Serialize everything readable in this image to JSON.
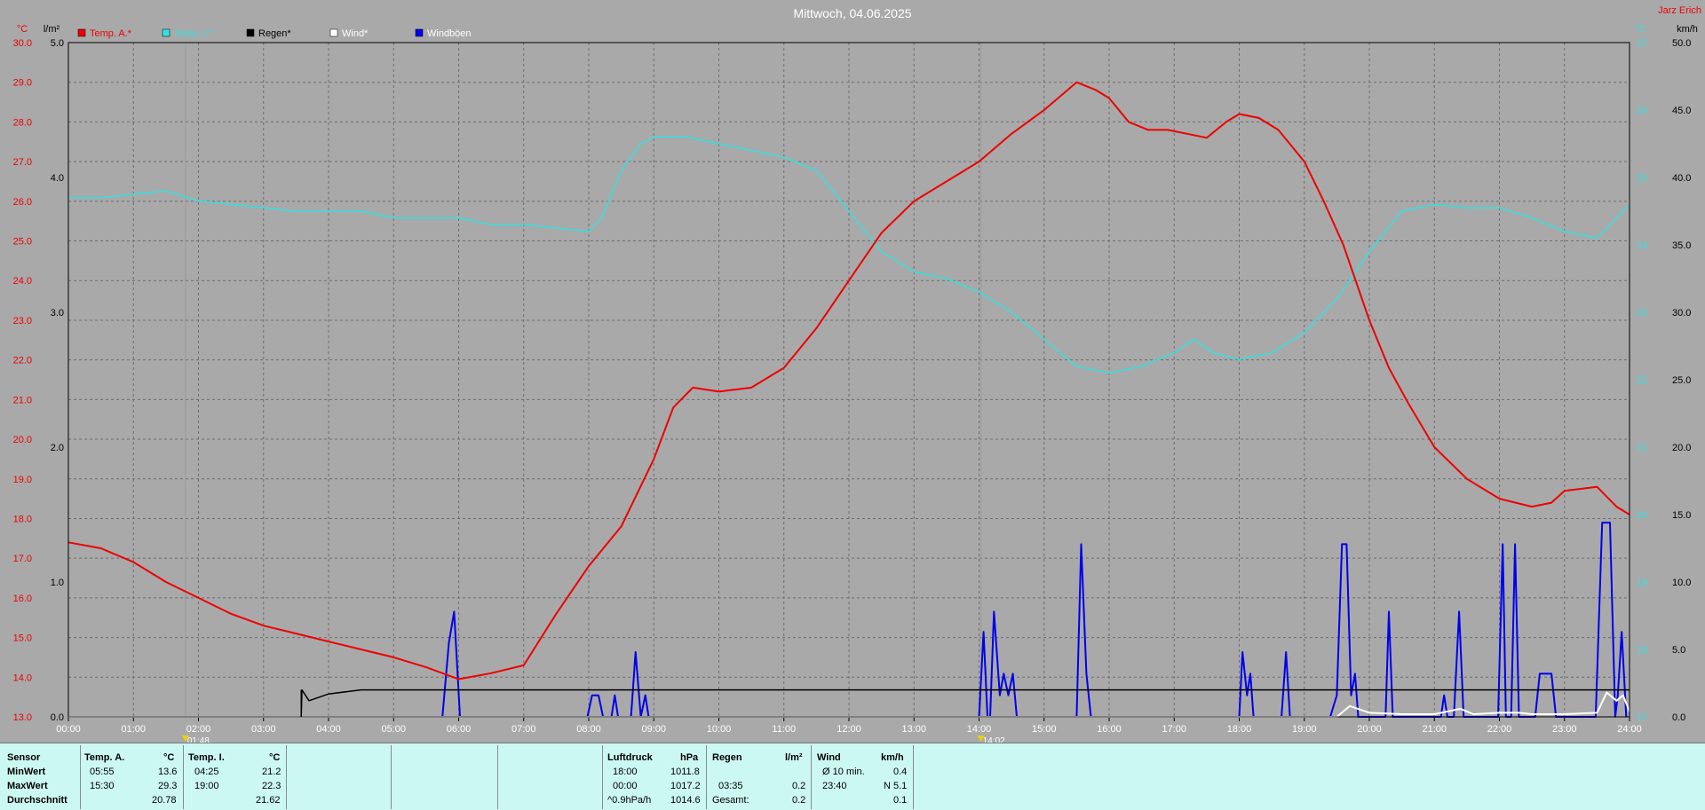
{
  "title": "Mittwoch, 04.06.2025",
  "author": "Jarz Erich",
  "colors": {
    "temp": "#ee0000",
    "tempi": "#34e0e0",
    "rain": "#000000",
    "wind": "#ffffff",
    "gusts": "#0000ee",
    "bg": "#a9a9a9"
  },
  "axes": {
    "left_unit": "°C",
    "left2_unit": "l/m²",
    "right_unit": "km/h",
    "right2_unit": "°C",
    "left_ticks": [
      "13.0",
      "14.0",
      "15.0",
      "16.0",
      "17.0",
      "18.0",
      "19.0",
      "20.0",
      "21.0",
      "22.0",
      "23.0",
      "24.0",
      "25.0",
      "26.0",
      "27.0",
      "28.0",
      "29.0",
      "30.0"
    ],
    "left2_ticks": [
      "0.0",
      "1.0",
      "2.0",
      "3.0",
      "4.0",
      "5.0"
    ],
    "right_ticks": [
      "0.0",
      "5.0",
      "10.0",
      "15.0",
      "20.0",
      "25.0",
      "30.0",
      "35.0",
      "40.0",
      "45.0",
      "50.0"
    ],
    "right2_ticks": [
      "17",
      "18",
      "19",
      "20",
      "21",
      "22",
      "23",
      "24",
      "25",
      "26",
      "27"
    ],
    "x_ticks": [
      "00:00",
      "01:00",
      "02:00",
      "03:00",
      "04:00",
      "05:00",
      "06:00",
      "07:00",
      "08:00",
      "09:00",
      "10:00",
      "11:00",
      "12:00",
      "13:00",
      "14:00",
      "15:00",
      "16:00",
      "17:00",
      "18:00",
      "19:00",
      "20:00",
      "21:00",
      "22:00",
      "23:00",
      "24:00"
    ],
    "markers": [
      {
        "time": "01:48",
        "t": 1.8
      },
      {
        "time": "14:02",
        "t": 14.03
      }
    ]
  },
  "legend": [
    {
      "label": "Temp. A.*",
      "color": "#ee0000",
      "text_color": "#ee0000"
    },
    {
      "label": "Temp. I.*",
      "color": "#34e0e0",
      "text_color": "#34e0e0"
    },
    {
      "label": "Regen*",
      "color": "#000000",
      "text_color": "#000000"
    },
    {
      "label": "Wind*",
      "color": "#ffffff",
      "text_color": "#ffffff"
    },
    {
      "label": "Windböen",
      "color": "#0000ee",
      "text_color": "#ffffff"
    }
  ],
  "chart_data": {
    "type": "line",
    "title": "Mittwoch, 04.06.2025",
    "x_unit": "hour of day",
    "xlim": [
      0,
      24
    ],
    "series": [
      {
        "name": "Temp. A.*",
        "unit": "°C",
        "axis": "left",
        "ylim": [
          13,
          30
        ],
        "points": [
          [
            0,
            17.4
          ],
          [
            0.5,
            17.25
          ],
          [
            1,
            16.9
          ],
          [
            1.5,
            16.4
          ],
          [
            2,
            16.0
          ],
          [
            2.5,
            15.6
          ],
          [
            3,
            15.3
          ],
          [
            3.5,
            15.1
          ],
          [
            4,
            14.9
          ],
          [
            4.5,
            14.7
          ],
          [
            5,
            14.5
          ],
          [
            5.5,
            14.25
          ],
          [
            6,
            13.95
          ],
          [
            6.5,
            14.1
          ],
          [
            7,
            14.3
          ],
          [
            7.5,
            15.6
          ],
          [
            8,
            16.8
          ],
          [
            8.5,
            17.8
          ],
          [
            9,
            19.5
          ],
          [
            9.3,
            20.8
          ],
          [
            9.6,
            21.3
          ],
          [
            10,
            21.2
          ],
          [
            10.5,
            21.3
          ],
          [
            11,
            21.8
          ],
          [
            11.5,
            22.8
          ],
          [
            12,
            24.0
          ],
          [
            12.5,
            25.2
          ],
          [
            13,
            26.0
          ],
          [
            13.5,
            26.5
          ],
          [
            14,
            27.0
          ],
          [
            14.5,
            27.7
          ],
          [
            15,
            28.3
          ],
          [
            15.5,
            29.0
          ],
          [
            15.8,
            28.8
          ],
          [
            16,
            28.6
          ],
          [
            16.3,
            28.0
          ],
          [
            16.6,
            27.8
          ],
          [
            16.9,
            27.8
          ],
          [
            17.2,
            27.7
          ],
          [
            17.5,
            27.6
          ],
          [
            17.8,
            28.0
          ],
          [
            18,
            28.2
          ],
          [
            18.3,
            28.1
          ],
          [
            18.6,
            27.8
          ],
          [
            19,
            27.0
          ],
          [
            19.3,
            26.0
          ],
          [
            19.6,
            24.9
          ],
          [
            20,
            23.0
          ],
          [
            20.3,
            21.8
          ],
          [
            20.6,
            20.9
          ],
          [
            21,
            19.8
          ],
          [
            21.5,
            19.0
          ],
          [
            22,
            18.5
          ],
          [
            22.5,
            18.3
          ],
          [
            22.8,
            18.4
          ],
          [
            23,
            18.7
          ],
          [
            23.5,
            18.8
          ],
          [
            23.8,
            18.3
          ],
          [
            24,
            18.1
          ]
        ]
      },
      {
        "name": "Temp. I.*",
        "unit": "°C",
        "axis": "right2",
        "ylim": [
          17,
          27
        ],
        "points": [
          [
            0,
            24.7
          ],
          [
            0.5,
            24.7
          ],
          [
            1,
            24.75
          ],
          [
            1.5,
            24.8
          ],
          [
            2,
            24.65
          ],
          [
            2.5,
            24.6
          ],
          [
            3,
            24.55
          ],
          [
            3.5,
            24.5
          ],
          [
            4,
            24.5
          ],
          [
            4.5,
            24.5
          ],
          [
            5,
            24.4
          ],
          [
            5.5,
            24.4
          ],
          [
            6,
            24.4
          ],
          [
            6.5,
            24.3
          ],
          [
            7,
            24.3
          ],
          [
            7.5,
            24.25
          ],
          [
            8,
            24.2
          ],
          [
            8.2,
            24.4
          ],
          [
            8.5,
            25.1
          ],
          [
            8.8,
            25.5
          ],
          [
            9,
            25.6
          ],
          [
            9.5,
            25.6
          ],
          [
            10,
            25.5
          ],
          [
            10.5,
            25.4
          ],
          [
            11,
            25.3
          ],
          [
            11.5,
            25.1
          ],
          [
            12,
            24.5
          ],
          [
            12.5,
            23.9
          ],
          [
            13,
            23.6
          ],
          [
            13.5,
            23.5
          ],
          [
            14,
            23.3
          ],
          [
            14.5,
            23.0
          ],
          [
            15,
            22.6
          ],
          [
            15.5,
            22.2
          ],
          [
            16,
            22.1
          ],
          [
            16.5,
            22.2
          ],
          [
            17,
            22.4
          ],
          [
            17.3,
            22.6
          ],
          [
            17.6,
            22.4
          ],
          [
            18,
            22.3
          ],
          [
            18.5,
            22.4
          ],
          [
            19,
            22.7
          ],
          [
            19.5,
            23.2
          ],
          [
            20,
            23.9
          ],
          [
            20.5,
            24.5
          ],
          [
            21,
            24.6
          ],
          [
            21.5,
            24.55
          ],
          [
            22,
            24.55
          ],
          [
            22.5,
            24.4
          ],
          [
            23,
            24.2
          ],
          [
            23.5,
            24.1
          ],
          [
            24,
            24.6
          ]
        ]
      },
      {
        "name": "Regen*",
        "unit": "l/m²",
        "axis": "left2",
        "ylim": [
          0,
          5
        ],
        "points": [
          [
            0,
            0
          ],
          [
            3.58,
            0
          ],
          [
            3.59,
            0.2
          ],
          [
            3.7,
            0.12
          ],
          [
            4,
            0.17
          ],
          [
            4.5,
            0.2
          ],
          [
            5,
            0.2
          ],
          [
            24,
            0.2
          ]
        ]
      },
      {
        "name": "Wind*",
        "unit": "km/h",
        "axis": "right",
        "ylim": [
          0,
          50
        ],
        "points": [
          [
            0,
            0
          ],
          [
            19.5,
            0
          ],
          [
            19.7,
            0.8
          ],
          [
            20,
            0.3
          ],
          [
            20.5,
            0.2
          ],
          [
            21,
            0.2
          ],
          [
            21.4,
            0.6
          ],
          [
            21.6,
            0.2
          ],
          [
            22,
            0.3
          ],
          [
            22.3,
            0.3
          ],
          [
            22.5,
            0.2
          ],
          [
            23,
            0.2
          ],
          [
            23.5,
            0.3
          ],
          [
            23.65,
            1.8
          ],
          [
            23.8,
            1.2
          ],
          [
            23.9,
            1.6
          ],
          [
            24,
            0.4
          ]
        ]
      },
      {
        "name": "Windböen",
        "unit": "km/h",
        "axis": "right",
        "points": [
          [
            0,
            0
          ],
          [
            5.75,
            0
          ],
          [
            5.85,
            5.5
          ],
          [
            5.93,
            7.8
          ],
          [
            6.02,
            0
          ],
          [
            7.98,
            0
          ],
          [
            8.05,
            1.6
          ],
          [
            8.15,
            1.6
          ],
          [
            8.22,
            0
          ],
          [
            8.35,
            0
          ],
          [
            8.4,
            1.6
          ],
          [
            8.45,
            0
          ],
          [
            8.65,
            0
          ],
          [
            8.72,
            4.8
          ],
          [
            8.8,
            0
          ],
          [
            8.87,
            1.6
          ],
          [
            8.92,
            0
          ],
          [
            14.0,
            0
          ],
          [
            14.07,
            6.3
          ],
          [
            14.13,
            0
          ],
          [
            14.17,
            0
          ],
          [
            14.23,
            7.8
          ],
          [
            14.32,
            1.6
          ],
          [
            14.38,
            3.2
          ],
          [
            14.45,
            1.6
          ],
          [
            14.52,
            3.2
          ],
          [
            14.58,
            0
          ],
          [
            15.5,
            0
          ],
          [
            15.57,
            12.8
          ],
          [
            15.65,
            3.2
          ],
          [
            15.72,
            0
          ],
          [
            18.0,
            0
          ],
          [
            18.05,
            4.8
          ],
          [
            18.12,
            1.6
          ],
          [
            18.17,
            3.2
          ],
          [
            18.22,
            0
          ],
          [
            18.65,
            0
          ],
          [
            18.72,
            4.8
          ],
          [
            18.78,
            0
          ],
          [
            19.4,
            0
          ],
          [
            19.5,
            1.6
          ],
          [
            19.58,
            12.8
          ],
          [
            19.65,
            12.8
          ],
          [
            19.72,
            1.6
          ],
          [
            19.78,
            3.2
          ],
          [
            19.83,
            0
          ],
          [
            20.25,
            0
          ],
          [
            20.3,
            7.8
          ],
          [
            20.36,
            0
          ],
          [
            21.1,
            0
          ],
          [
            21.15,
            1.6
          ],
          [
            21.2,
            0
          ],
          [
            21.3,
            0
          ],
          [
            21.38,
            7.8
          ],
          [
            21.45,
            0
          ],
          [
            21.98,
            0
          ],
          [
            22.05,
            12.8
          ],
          [
            22.1,
            0
          ],
          [
            22.18,
            0
          ],
          [
            22.24,
            12.8
          ],
          [
            22.3,
            0
          ],
          [
            22.55,
            0
          ],
          [
            22.62,
            3.2
          ],
          [
            22.8,
            3.2
          ],
          [
            22.87,
            0
          ],
          [
            23.48,
            0
          ],
          [
            23.58,
            14.4
          ],
          [
            23.7,
            14.4
          ],
          [
            23.78,
            0
          ],
          [
            23.82,
            1.6
          ],
          [
            23.88,
            6.3
          ],
          [
            23.95,
            0
          ]
        ]
      }
    ]
  },
  "stats": {
    "headers": {
      "sensor": "Sensor",
      "temp_a": "Temp. A.",
      "temp_a_unit": "°C",
      "temp_i": "Temp. I.",
      "temp_i_unit": "°C",
      "pressure": "Luftdruck",
      "pressure_unit": "hPa",
      "rain": "Regen",
      "rain_unit": "l/m²",
      "wind": "Wind",
      "wind_unit": "km/h"
    },
    "rows": {
      "min": "MinWert",
      "max": "MaxWert",
      "avg": "Durchschnitt"
    },
    "temp_a": {
      "min_time": "05:55",
      "min_val": "13.6",
      "max_time": "15:30",
      "max_val": "29.3",
      "avg": "20.78"
    },
    "temp_i": {
      "min_time": "04:25",
      "min_val": "21.2",
      "max_time": "19:00",
      "max_val": "22.3",
      "avg": "21.62"
    },
    "pressure": {
      "min_time": "18:00",
      "min_val": "1011.8",
      "max_time": "00:00",
      "max_val": "1017.2",
      "trend_label": "^0.9hPa/h",
      "trend_val": "1014.6"
    },
    "rain": {
      "max_time": "03:35",
      "max_val": "0.2",
      "total_label": "Gesamt:",
      "total_val": "0.2"
    },
    "wind": {
      "avg_label": "Ø 10 min.",
      "avg_val": "0.4",
      "max_time": "23:40",
      "max_val": "N 5.1",
      "last_val": "0.1"
    }
  }
}
